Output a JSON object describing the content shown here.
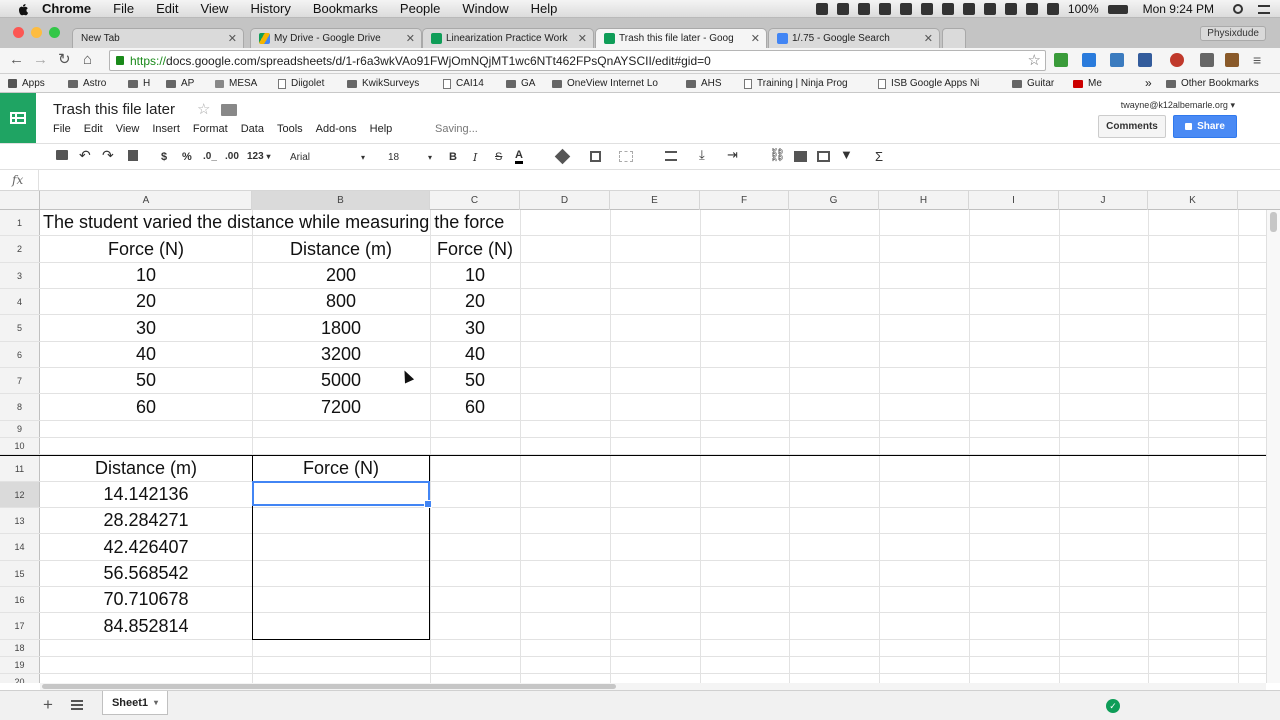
{
  "menubar": {
    "app": "Chrome",
    "items": [
      "File",
      "Edit",
      "View",
      "History",
      "Bookmarks",
      "People",
      "Window",
      "Help"
    ],
    "battery": "100%",
    "clock": "Mon 9:24 PM"
  },
  "tabs": [
    {
      "title": "New Tab",
      "active": false
    },
    {
      "title": "My Drive - Google Drive",
      "active": false
    },
    {
      "title": "Linearization Practice Work",
      "active": false
    },
    {
      "title": "Trash this file later - Goog",
      "active": true
    },
    {
      "title": "1/.75 - Google Search",
      "active": false
    }
  ],
  "profile": "Physixdude",
  "address": {
    "scheme": "https://",
    "rest": "docs.google.com/spreadsheets/d/1-r6a3wkVAo91FWjOmNQjMT1wc6NTt462FPsQnAYSCII/edit#gid=0"
  },
  "bookmarks": [
    "Apps",
    "Astro",
    "H",
    "AP",
    "MESA",
    "Diigolet",
    "KwikSurveys",
    "CAI14",
    "GA",
    "OneView Internet Lo",
    "AHS",
    "Training | Ninja Prog",
    "ISB Google Apps Ni",
    "Guitar",
    "Me"
  ],
  "bookmarks_more": "»",
  "other_bookmarks": "Other Bookmarks",
  "doc": {
    "title": "Trash this file later",
    "menus": [
      "File",
      "Edit",
      "View",
      "Insert",
      "Format",
      "Data",
      "Tools",
      "Add-ons",
      "Help"
    ],
    "status": "Saving...",
    "user": "twayne@k12albemarle.org",
    "comments_label": "Comments",
    "share_label": "Share"
  },
  "format_toolbar": {
    "currency": "$",
    "percent": "%",
    "dec_less": ".0_",
    "dec_more": ".00",
    "more_formats": "123",
    "font": "Arial",
    "size": "18",
    "bold": "B",
    "italic": "I",
    "strike": "S",
    "text_color": "A",
    "sum": "Σ"
  },
  "formula_bar": {
    "fx": "fx",
    "value": ""
  },
  "columns": [
    "A",
    "B",
    "C",
    "D",
    "E",
    "F",
    "G",
    "H",
    "I",
    "J",
    "K"
  ],
  "rows": [
    {
      "n": "1",
      "a": "The student varied the distance while measuring the force",
      "b": "",
      "c": ""
    },
    {
      "n": "2",
      "a": "Force (N)",
      "b": "Distance (m)",
      "c": "Force (N)"
    },
    {
      "n": "3",
      "a": "10",
      "b": "200",
      "c": "10"
    },
    {
      "n": "4",
      "a": "20",
      "b": "800",
      "c": "20"
    },
    {
      "n": "5",
      "a": "30",
      "b": "1800",
      "c": "30"
    },
    {
      "n": "6",
      "a": "40",
      "b": "3200",
      "c": "40"
    },
    {
      "n": "7",
      "a": "50",
      "b": "5000",
      "c": "50"
    },
    {
      "n": "8",
      "a": "60",
      "b": "7200",
      "c": "60"
    },
    {
      "n": "9",
      "a": "",
      "b": "",
      "c": ""
    },
    {
      "n": "10",
      "a": "",
      "b": "",
      "c": ""
    },
    {
      "n": "11",
      "a": "Distance (m)",
      "b": "Force (N)",
      "c": ""
    },
    {
      "n": "12",
      "a": "14.142136",
      "b": "",
      "c": ""
    },
    {
      "n": "13",
      "a": "28.284271",
      "b": "",
      "c": ""
    },
    {
      "n": "14",
      "a": "42.426407",
      "b": "",
      "c": ""
    },
    {
      "n": "15",
      "a": "56.568542",
      "b": "",
      "c": ""
    },
    {
      "n": "16",
      "a": "70.710678",
      "b": "",
      "c": ""
    },
    {
      "n": "17",
      "a": "84.852814",
      "b": "",
      "c": ""
    },
    {
      "n": "18",
      "a": "",
      "b": "",
      "c": ""
    },
    {
      "n": "19",
      "a": "",
      "b": "",
      "c": ""
    },
    {
      "n": "20",
      "a": "",
      "b": "",
      "c": ""
    }
  ],
  "selected_cell": "B12",
  "sheet_tabs": [
    {
      "name": "Sheet1"
    }
  ],
  "add_sheet": "+"
}
